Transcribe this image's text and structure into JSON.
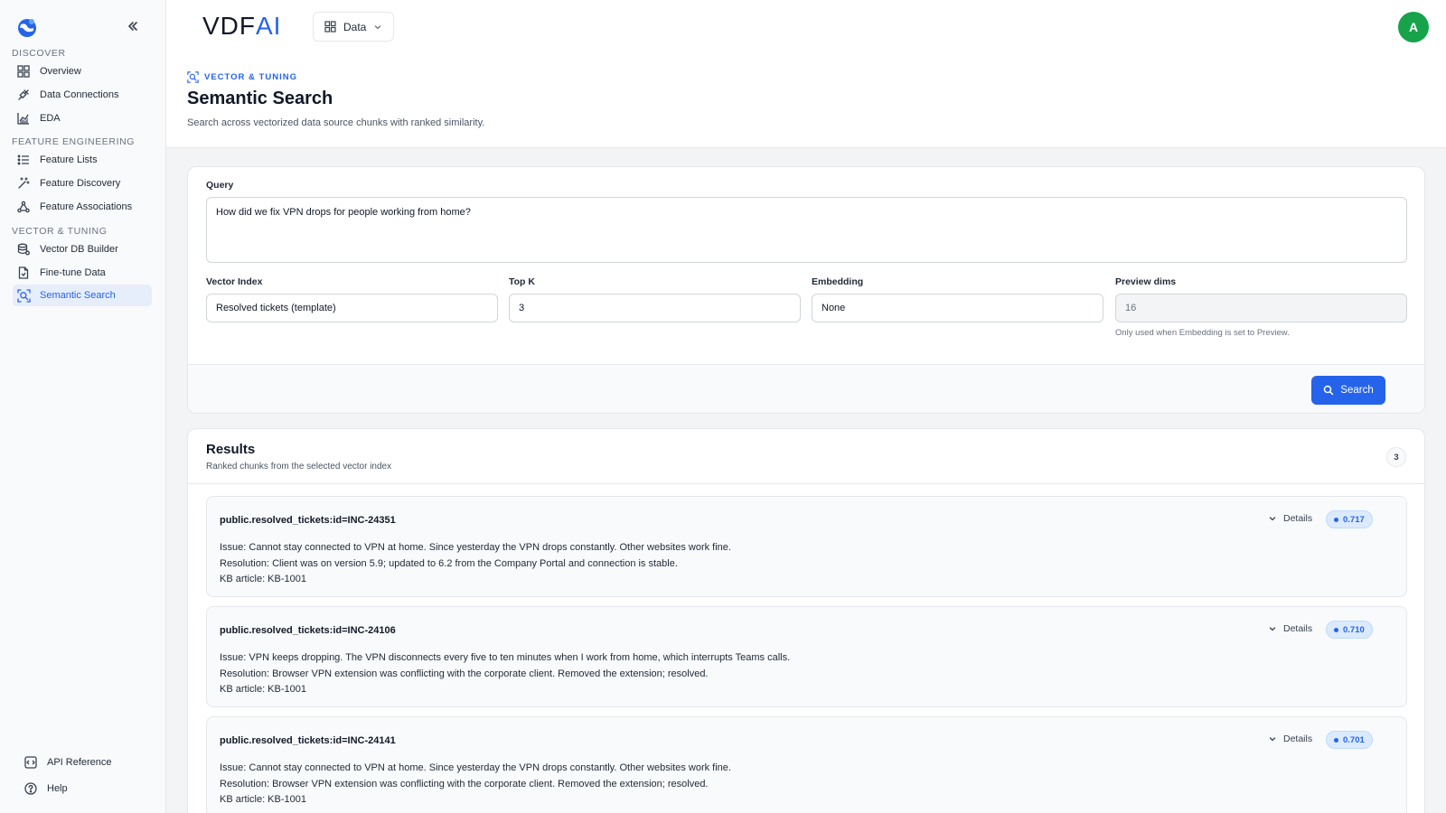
{
  "sidebar": {
    "sections": [
      {
        "label": "DISCOVER",
        "items": [
          {
            "label": "Overview",
            "icon": "grid-icon"
          },
          {
            "label": "Data Connections",
            "icon": "plug-icon"
          },
          {
            "label": "EDA",
            "icon": "chart-icon"
          }
        ]
      },
      {
        "label": "FEATURE ENGINEERING",
        "items": [
          {
            "label": "Feature Lists",
            "icon": "list-icon"
          },
          {
            "label": "Feature Discovery",
            "icon": "magic-wand-icon"
          },
          {
            "label": "Feature Associations",
            "icon": "network-icon"
          }
        ]
      },
      {
        "label": "VECTOR & TUNING",
        "items": [
          {
            "label": "Vector DB Builder",
            "icon": "database-icon"
          },
          {
            "label": "Fine-tune Data",
            "icon": "file-icon"
          },
          {
            "label": "Semantic Search",
            "icon": "search-scan-icon",
            "active": true
          }
        ]
      }
    ],
    "bottom": [
      {
        "label": "API Reference",
        "icon": "code-icon"
      },
      {
        "label": "Help",
        "icon": "help-icon"
      }
    ]
  },
  "header": {
    "brand_main": "VDF",
    "brand_accent": "AI",
    "workspace": "Data",
    "avatar_initial": "A",
    "eyebrow": "VECTOR & TUNING",
    "title": "Semantic Search",
    "subtitle": "Search across vectorized data source chunks with ranked similarity."
  },
  "query": {
    "label": "Query",
    "value": "How did we fix VPN drops for people working from home?",
    "fields": [
      {
        "label": "Vector Index",
        "value": "Resolved tickets (template)"
      },
      {
        "label": "Top K",
        "value": "3"
      },
      {
        "label": "Embedding",
        "value": "None"
      },
      {
        "label": "Preview dims",
        "value": "16"
      }
    ],
    "hint": "Only used when Embedding is set to Preview.",
    "search_label": "Search"
  },
  "results": {
    "title": "Results",
    "subtitle": "Ranked chunks from the selected vector index",
    "count": "3",
    "details_label": "Details",
    "items": [
      {
        "id": "public.resolved_tickets:id=INC-24351",
        "score": "0.717",
        "issue": "Issue: Cannot stay connected to VPN at home. Since yesterday the VPN drops constantly. Other websites work fine.",
        "resolution": "Resolution: Client was on version 5.9; updated to 6.2 from the Company Portal and connection is stable.",
        "kb": "KB article: KB-1001"
      },
      {
        "id": "public.resolved_tickets:id=INC-24106",
        "score": "0.710",
        "issue": "Issue: VPN keeps dropping. The VPN disconnects every five to ten minutes when I work from home, which interrupts Teams calls.",
        "resolution": "Resolution: Browser VPN extension was conflicting with the corporate client. Removed the extension; resolved.",
        "kb": "KB article: KB-1001"
      },
      {
        "id": "public.resolved_tickets:id=INC-24141",
        "score": "0.701",
        "issue": "Issue: Cannot stay connected to VPN at home. Since yesterday the VPN drops constantly. Other websites work fine.",
        "resolution": "Resolution: Browser VPN extension was conflicting with the corporate client. Removed the extension; resolved.",
        "kb": "KB article: KB-1001"
      }
    ]
  },
  "colors": {
    "accent": "#2563eb",
    "avatar": "#16a34a",
    "active_nav_bg": "#e6eefc"
  }
}
